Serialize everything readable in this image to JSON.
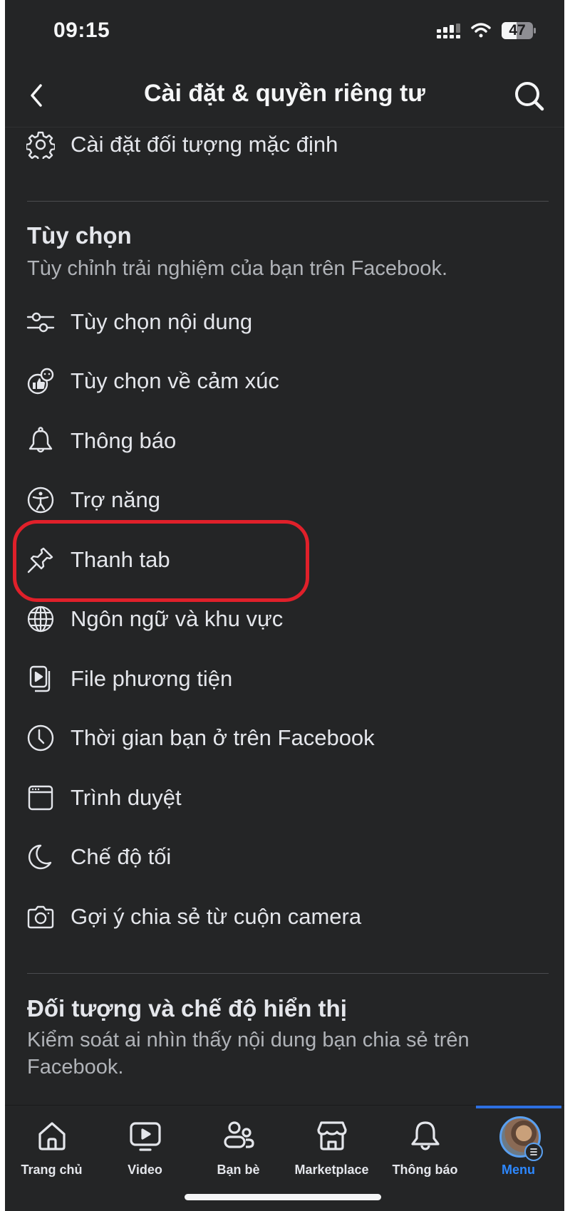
{
  "status_bar": {
    "time": "09:15",
    "battery_level": "47",
    "icons": [
      "cellular-signal-icon",
      "wifi-icon",
      "battery-icon"
    ]
  },
  "header": {
    "title": "Cài đặt & quyền riêng tư",
    "back_icon": "chevron-left-icon",
    "search_icon": "search-icon"
  },
  "top_item": {
    "label": "Cài đặt đối tượng mặc định",
    "icon": "gear-icon"
  },
  "preferences": {
    "title": "Tùy chọn",
    "subtitle": "Tùy chỉnh trải nghiệm của bạn trên Facebook.",
    "items": [
      {
        "label": "Tùy chọn nội dung",
        "icon": "sliders-icon"
      },
      {
        "label": "Tùy chọn về cảm xúc",
        "icon": "reactions-icon"
      },
      {
        "label": "Thông báo",
        "icon": "bell-icon"
      },
      {
        "label": "Trợ năng",
        "icon": "accessibility-icon"
      },
      {
        "label": "Thanh tab",
        "icon": "pin-icon",
        "highlighted": true
      },
      {
        "label": "Ngôn ngữ và khu vực",
        "icon": "globe-icon"
      },
      {
        "label": "File phương tiện",
        "icon": "media-file-icon"
      },
      {
        "label": "Thời gian bạn ở trên Facebook",
        "icon": "clock-icon"
      },
      {
        "label": "Trình duyệt",
        "icon": "browser-icon"
      },
      {
        "label": "Chế độ tối",
        "icon": "moon-icon"
      },
      {
        "label": "Gợi ý chia sẻ từ cuộn camera",
        "icon": "camera-icon"
      }
    ]
  },
  "audience": {
    "title": "Đối tượng và chế độ hiển thị",
    "subtitle": "Kiểm soát ai nhìn thấy nội dung bạn chia sẻ trên Facebook."
  },
  "bottom_nav": {
    "items": [
      {
        "label": "Trang chủ",
        "icon": "home-icon"
      },
      {
        "label": "Video",
        "icon": "video-icon"
      },
      {
        "label": "Bạn bè",
        "icon": "friends-icon"
      },
      {
        "label": "Marketplace",
        "icon": "marketplace-icon"
      },
      {
        "label": "Thông báo",
        "icon": "bell-icon"
      },
      {
        "label": "Menu",
        "icon": "avatar-menu-icon",
        "active": true
      }
    ],
    "active_color": "#2d88ff"
  },
  "colors": {
    "background": "#242526",
    "text_primary": "#e4e6eb",
    "text_secondary": "#b0b3b8",
    "highlight_outline": "#e0202a",
    "accent": "#2d88ff"
  }
}
